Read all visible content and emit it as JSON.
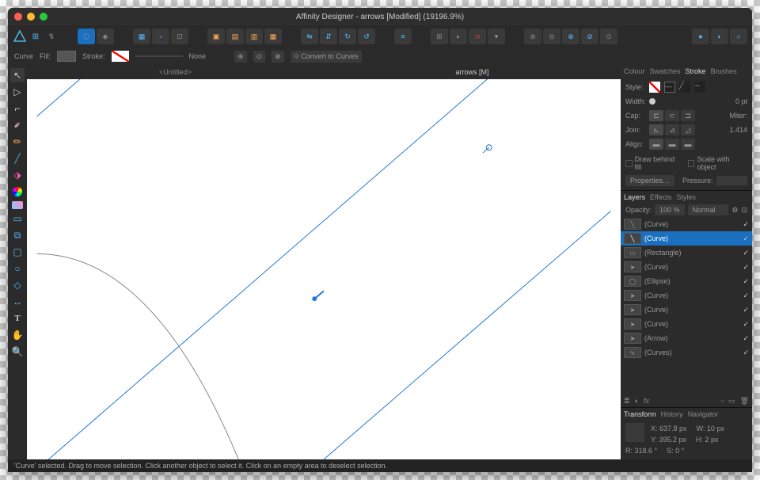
{
  "window": {
    "title": "Affinity Designer - arrows [Modified] (19196.9%)"
  },
  "context": {
    "label": "Curve",
    "fill": "Fill:",
    "stroke": "Stroke:",
    "strokeVal": "None",
    "convert": "Convert to Curves"
  },
  "doctabs": [
    {
      "label": "<Untitled>",
      "active": false
    },
    {
      "label": "arrows [M]",
      "active": true
    }
  ],
  "strokePanel": {
    "tabs": [
      "Colour",
      "Swatches",
      "Stroke",
      "Brushes"
    ],
    "activeTab": "Stroke",
    "styleLabel": "Style:",
    "widthLabel": "Width:",
    "widthVal": "0 pt",
    "capLabel": "Cap:",
    "joinLabel": "Join:",
    "miterLabel": "Miter:",
    "miterVal": "1.414",
    "alignLabel": "Align:",
    "drawBehind": "Draw behind fill",
    "scaleObj": "Scale with object",
    "properties": "Properties…",
    "pressure": "Pressure:"
  },
  "layersPanel": {
    "tabs": [
      "Layers",
      "Effects",
      "Styles"
    ],
    "activeTab": "Layers",
    "opacityLabel": "Opacity:",
    "opacityVal": "100 %",
    "blendVal": "Normal",
    "layers": [
      {
        "name": "(Curve)",
        "icon": "line",
        "sel": false,
        "vis": true
      },
      {
        "name": "(Curve)",
        "icon": "line",
        "sel": true,
        "vis": true
      },
      {
        "name": "(Rectangle)",
        "icon": "rect",
        "sel": false,
        "vis": true
      },
      {
        "name": "(Curve)",
        "icon": "arrow",
        "sel": false,
        "vis": true
      },
      {
        "name": "(Ellipse)",
        "icon": "ellipse",
        "sel": false,
        "vis": true
      },
      {
        "name": "(Curve)",
        "icon": "arrow",
        "sel": false,
        "vis": true
      },
      {
        "name": "(Curve)",
        "icon": "arrow",
        "sel": false,
        "vis": true
      },
      {
        "name": "(Curve)",
        "icon": "arrow",
        "sel": false,
        "vis": true
      },
      {
        "name": "(Arrow)",
        "icon": "arrow",
        "sel": false,
        "vis": true
      },
      {
        "name": "(Curves)",
        "icon": "curves",
        "sel": false,
        "vis": true
      }
    ]
  },
  "transform": {
    "tabs": [
      "Transform",
      "History",
      "Navigator"
    ],
    "activeTab": "Transform",
    "x": "X: 637.8 px",
    "w": "W: 10 px",
    "y": "Y: 395.2 px",
    "h": "H: 2 px",
    "r": "R: 318.6 °",
    "s": "S: 0 °"
  },
  "status": "'Curve' selected. Drag to move selection. Click another object to select it. Click on an empty area to deselect selection."
}
